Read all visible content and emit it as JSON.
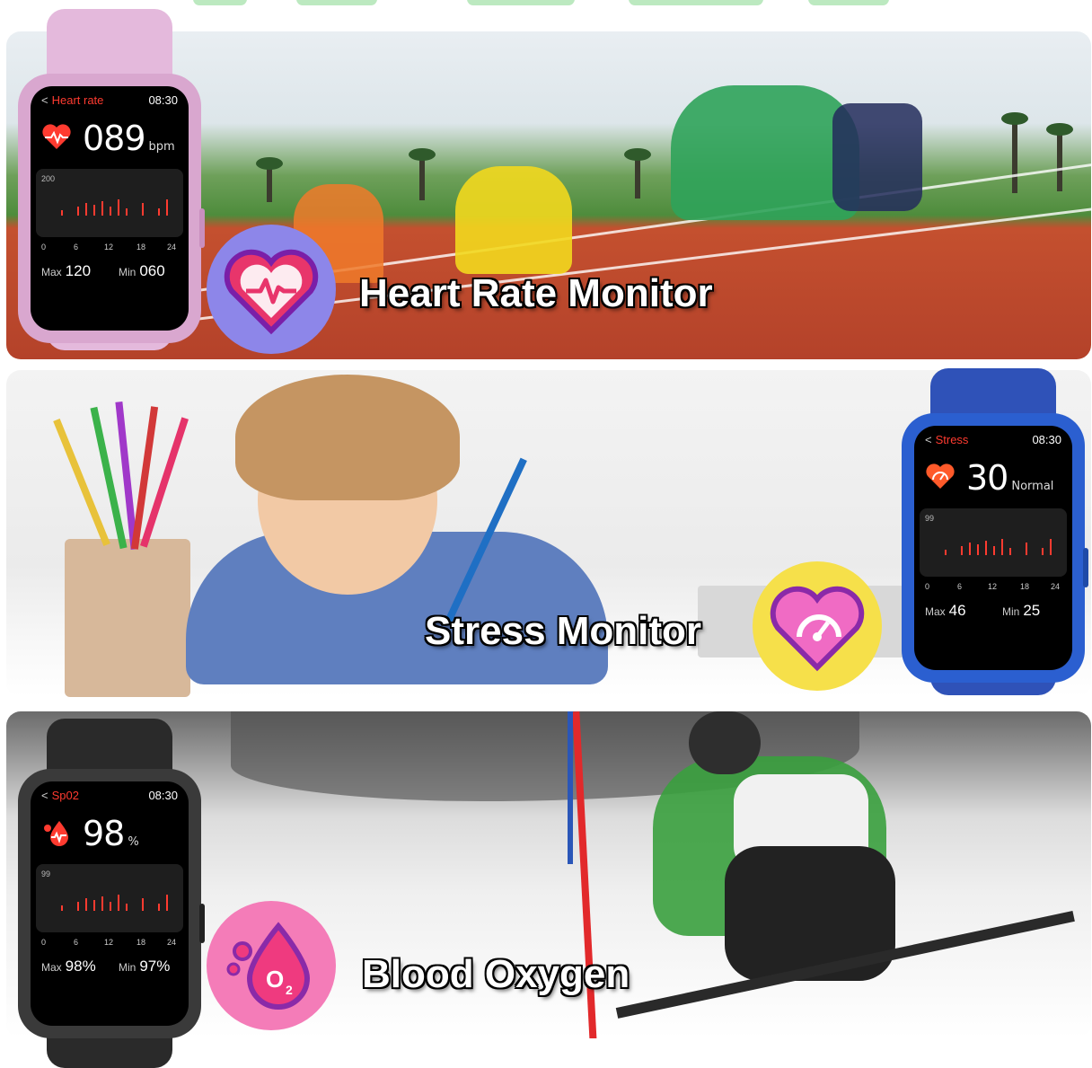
{
  "features": [
    {
      "caption": "Heart Rate Monitor",
      "watch": {
        "label": "Heart rate",
        "time": "08:30",
        "value": "089",
        "unit": "bpm",
        "chart_max": "200",
        "ticks": [
          "0",
          "6",
          "12",
          "18",
          "24"
        ],
        "max_label": "Max",
        "max_value": "120",
        "min_label": "Min",
        "min_value": "060",
        "band_color": "#e4b9dc",
        "case_color": "#d9a7cf"
      },
      "badge_color": "#8d86e9",
      "icon": "heart-pulse-icon"
    },
    {
      "caption": "Stress Monitor",
      "watch": {
        "label": "Stress",
        "time": "08:30",
        "value": "30",
        "unit": "Normal",
        "chart_max": "99",
        "ticks": [
          "0",
          "6",
          "12",
          "18",
          "24"
        ],
        "max_label": "Max",
        "max_value": "46",
        "min_label": "Min",
        "min_value": "25",
        "band_color": "#2f52b8",
        "case_color": "#2b5fd0"
      },
      "badge_color": "#f6e04a",
      "icon": "heart-gauge-icon"
    },
    {
      "caption": "Blood Oxygen",
      "watch": {
        "label": "Sp02",
        "time": "08:30",
        "value": "98",
        "unit": "%",
        "chart_max": "99",
        "ticks": [
          "0",
          "6",
          "12",
          "18",
          "24"
        ],
        "max_label": "Max",
        "max_value": "98%",
        "min_label": "Min",
        "min_value": "97%",
        "band_color": "#2a2a2a",
        "case_color": "#3a3a3a"
      },
      "badge_color": "#f47cb8",
      "icon": "oxygen-drop-icon"
    }
  ]
}
